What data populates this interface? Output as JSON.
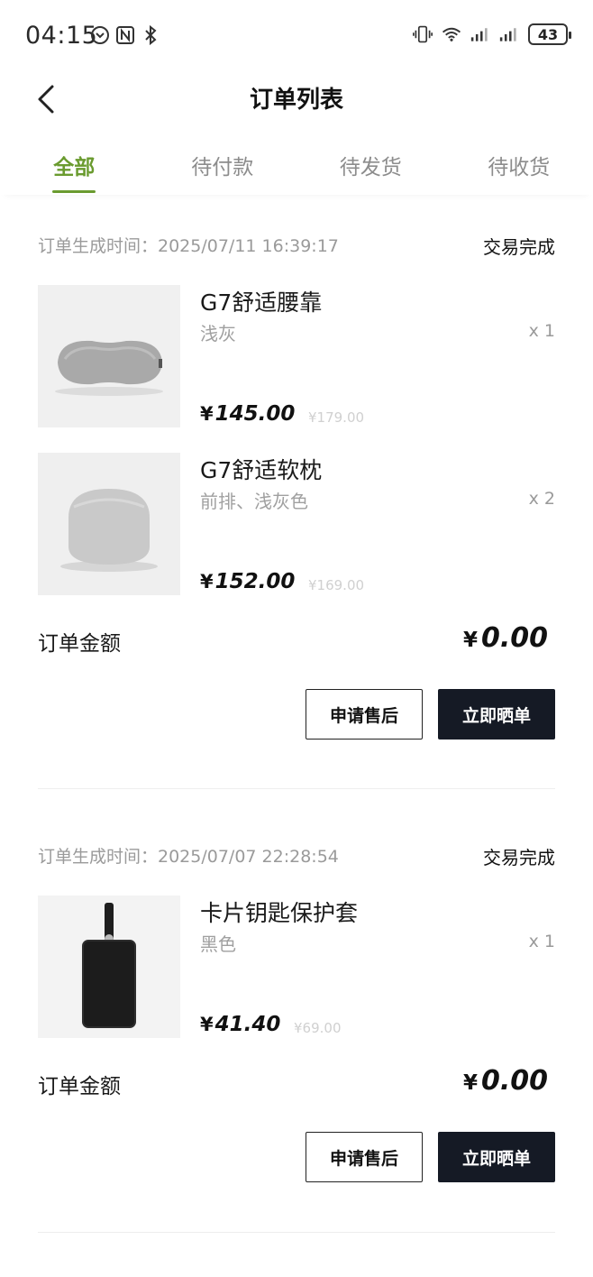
{
  "status_bar": {
    "time": "04:15",
    "battery": "43",
    "icons": [
      "accessibility-icon",
      "nfc-icon",
      "bluetooth-icon",
      "vibrate-icon",
      "wifi-icon",
      "signal-icon",
      "signal-icon-2"
    ]
  },
  "header": {
    "title": "订单列表",
    "back_icon": "chevron-left-icon"
  },
  "tabs": [
    {
      "label": "全部",
      "active": true
    },
    {
      "label": "待付款",
      "active": false
    },
    {
      "label": "待发货",
      "active": false
    },
    {
      "label": "待收货",
      "active": false
    }
  ],
  "colors": {
    "accent": "#6a9b2f",
    "dark_button": "#151a25"
  },
  "orders": [
    {
      "time": "订单生成时间：2025/07/11 16:39:17",
      "status": "交易完成",
      "items": [
        {
          "name": "G7舒适腰靠",
          "spec": "浅灰",
          "qty": "x 1",
          "price": "145.00",
          "orig": "¥179.00",
          "image": "gray-lumbar-cushion"
        },
        {
          "name": "G7舒适软枕",
          "spec": "前排、浅灰色",
          "qty": "x 2",
          "price": "152.00",
          "orig": "¥169.00",
          "image": "gray-soft-pillow"
        }
      ],
      "total_label": "订单金额",
      "total": "0.00",
      "actions": {
        "after_sale": "申请售后",
        "review": "立即晒单"
      }
    },
    {
      "time": "订单生成时间：2025/07/07 22:28:54",
      "status": "交易完成",
      "items": [
        {
          "name": "卡片钥匙保护套",
          "spec": "黑色",
          "qty": "x 1",
          "price": "41.40",
          "orig": "¥69.00",
          "image": "black-card-key-cover"
        }
      ],
      "total_label": "订单金额",
      "total": "0.00",
      "actions": {
        "after_sale": "申请售后",
        "review": "立即晒单"
      }
    }
  ],
  "currency": "¥"
}
